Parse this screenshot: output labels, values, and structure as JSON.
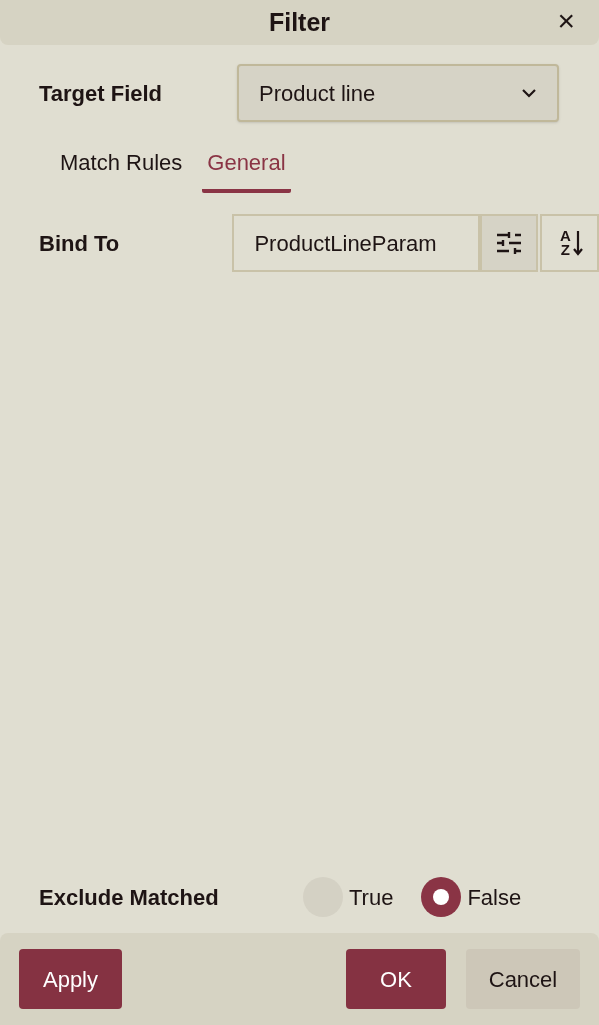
{
  "dialog": {
    "title": "Filter",
    "close": "×"
  },
  "target_field": {
    "label": "Target Field",
    "value": "Product line"
  },
  "tabs": [
    {
      "label": "Match Rules",
      "selected": false
    },
    {
      "label": "General",
      "selected": true
    }
  ],
  "bind_to": {
    "label": "Bind To",
    "value": "ProductLineParam",
    "sort_icon_letters": [
      "A",
      "Z"
    ]
  },
  "exclude_matched": {
    "label": "Exclude Matched",
    "options": [
      {
        "label": "True",
        "selected": false
      },
      {
        "label": "False",
        "selected": true
      }
    ]
  },
  "buttons": [
    {
      "label": "Apply",
      "kind": "primary"
    },
    {
      "label": "OK",
      "kind": "primary"
    },
    {
      "label": "Cancel",
      "kind": "secondary"
    }
  ]
}
